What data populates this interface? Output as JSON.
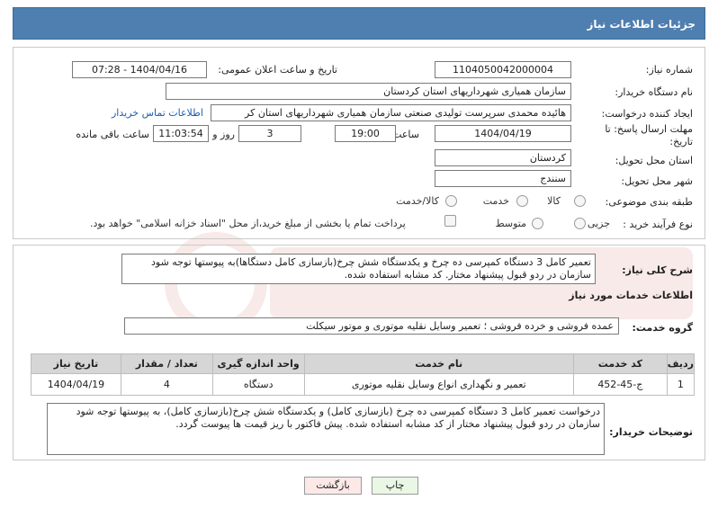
{
  "header": {
    "title": "جزئیات اطلاعات نیاز"
  },
  "form": {
    "need_number": {
      "label": "شماره نیاز:",
      "value": "1104050042000004"
    },
    "announce_datetime": {
      "label": "تاریخ و ساعت اعلان عمومی:",
      "value": "1404/04/16 - 07:28"
    },
    "buyer_org": {
      "label": "نام دستگاه خریدار:",
      "value": "سازمان همیاری شهرداریهای استان کردستان"
    },
    "requester": {
      "label": "ایجاد کننده درخواست:",
      "value": "هائیده محمدی سرپرست تولیدی صنعتی سازمان همیاری شهرداریهای استان کر"
    },
    "buyer_contact_link": "اطلاعات تماس خریدار",
    "deadline": {
      "label_line1": "مهلت ارسال پاسخ: تا",
      "label_line2": "تاریخ:",
      "date": "1404/04/19",
      "time_label": "ساعت",
      "time": "19:00",
      "days": "3",
      "days_label": "روز و",
      "remaining": "11:03:54",
      "remaining_label": "ساعت باقی مانده"
    },
    "province": {
      "label": "استان محل تحویل:",
      "value": "کردستان"
    },
    "city": {
      "label": "شهر محل تحویل:",
      "value": "سنندج"
    },
    "category": {
      "label": "طبقه بندی موضوعی:",
      "options": [
        "کالا",
        "خدمت",
        "کالا/خدمت"
      ]
    },
    "process": {
      "label": "نوع فرآیند خرید :",
      "options": [
        "جزیی",
        "متوسط"
      ],
      "payment_note": "پرداخت تمام یا بخشی از مبلغ خرید،از محل \"اسناد خزانه اسلامی\" خواهد بود."
    }
  },
  "summary": {
    "label": "شرح کلی نیاز:",
    "text": "تعمیر کامل 3 دستگاه کمپرسی ده چرخ و یکدستگاه شش چرخ(بازسازی کامل دستگاها)به پیوستها توجه شود سازمان در ردو قبول پیشنهاد مختار. کد مشابه استفاده شده."
  },
  "services": {
    "title": "اطلاعات خدمات مورد نیاز",
    "group_label": "گروه خدمت:",
    "group_value": "عمده فروشی و خرده فروشی ؛ تعمیر وسایل نقلیه موتوری و موتور سیکلت",
    "columns": [
      "ردیف",
      "کد خدمت",
      "نام خدمت",
      "واحد اندازه گیری",
      "تعداد / مقدار",
      "تاریخ نیاز"
    ],
    "rows": [
      [
        "1",
        "ج-45-452",
        "تعمیر و نگهداری انواع وسایل نقلیه موتوری",
        "دستگاه",
        "4",
        "1404/04/19"
      ]
    ]
  },
  "buyer_notes": {
    "label": "توضیحات خریدار:",
    "text": "درخواست تعمیر کامل 3 دستگاه کمپرسی ده چرخ (بازسازی کامل) و یکدستگاه شش چرخ(بازسازی کامل)، به پیوستها توجه شود سازمان در ردو قبول پیشنهاد مختار از کد مشابه استفاده شده. پیش فاکتور با ریز قیمت ها پیوست گردد."
  },
  "buttons": {
    "print": "چاپ",
    "back": "بازگشت"
  },
  "colors": {
    "header_bg": "#4f7fb0",
    "link": "#1b5fb0",
    "table_header": "#d6d6d6"
  }
}
